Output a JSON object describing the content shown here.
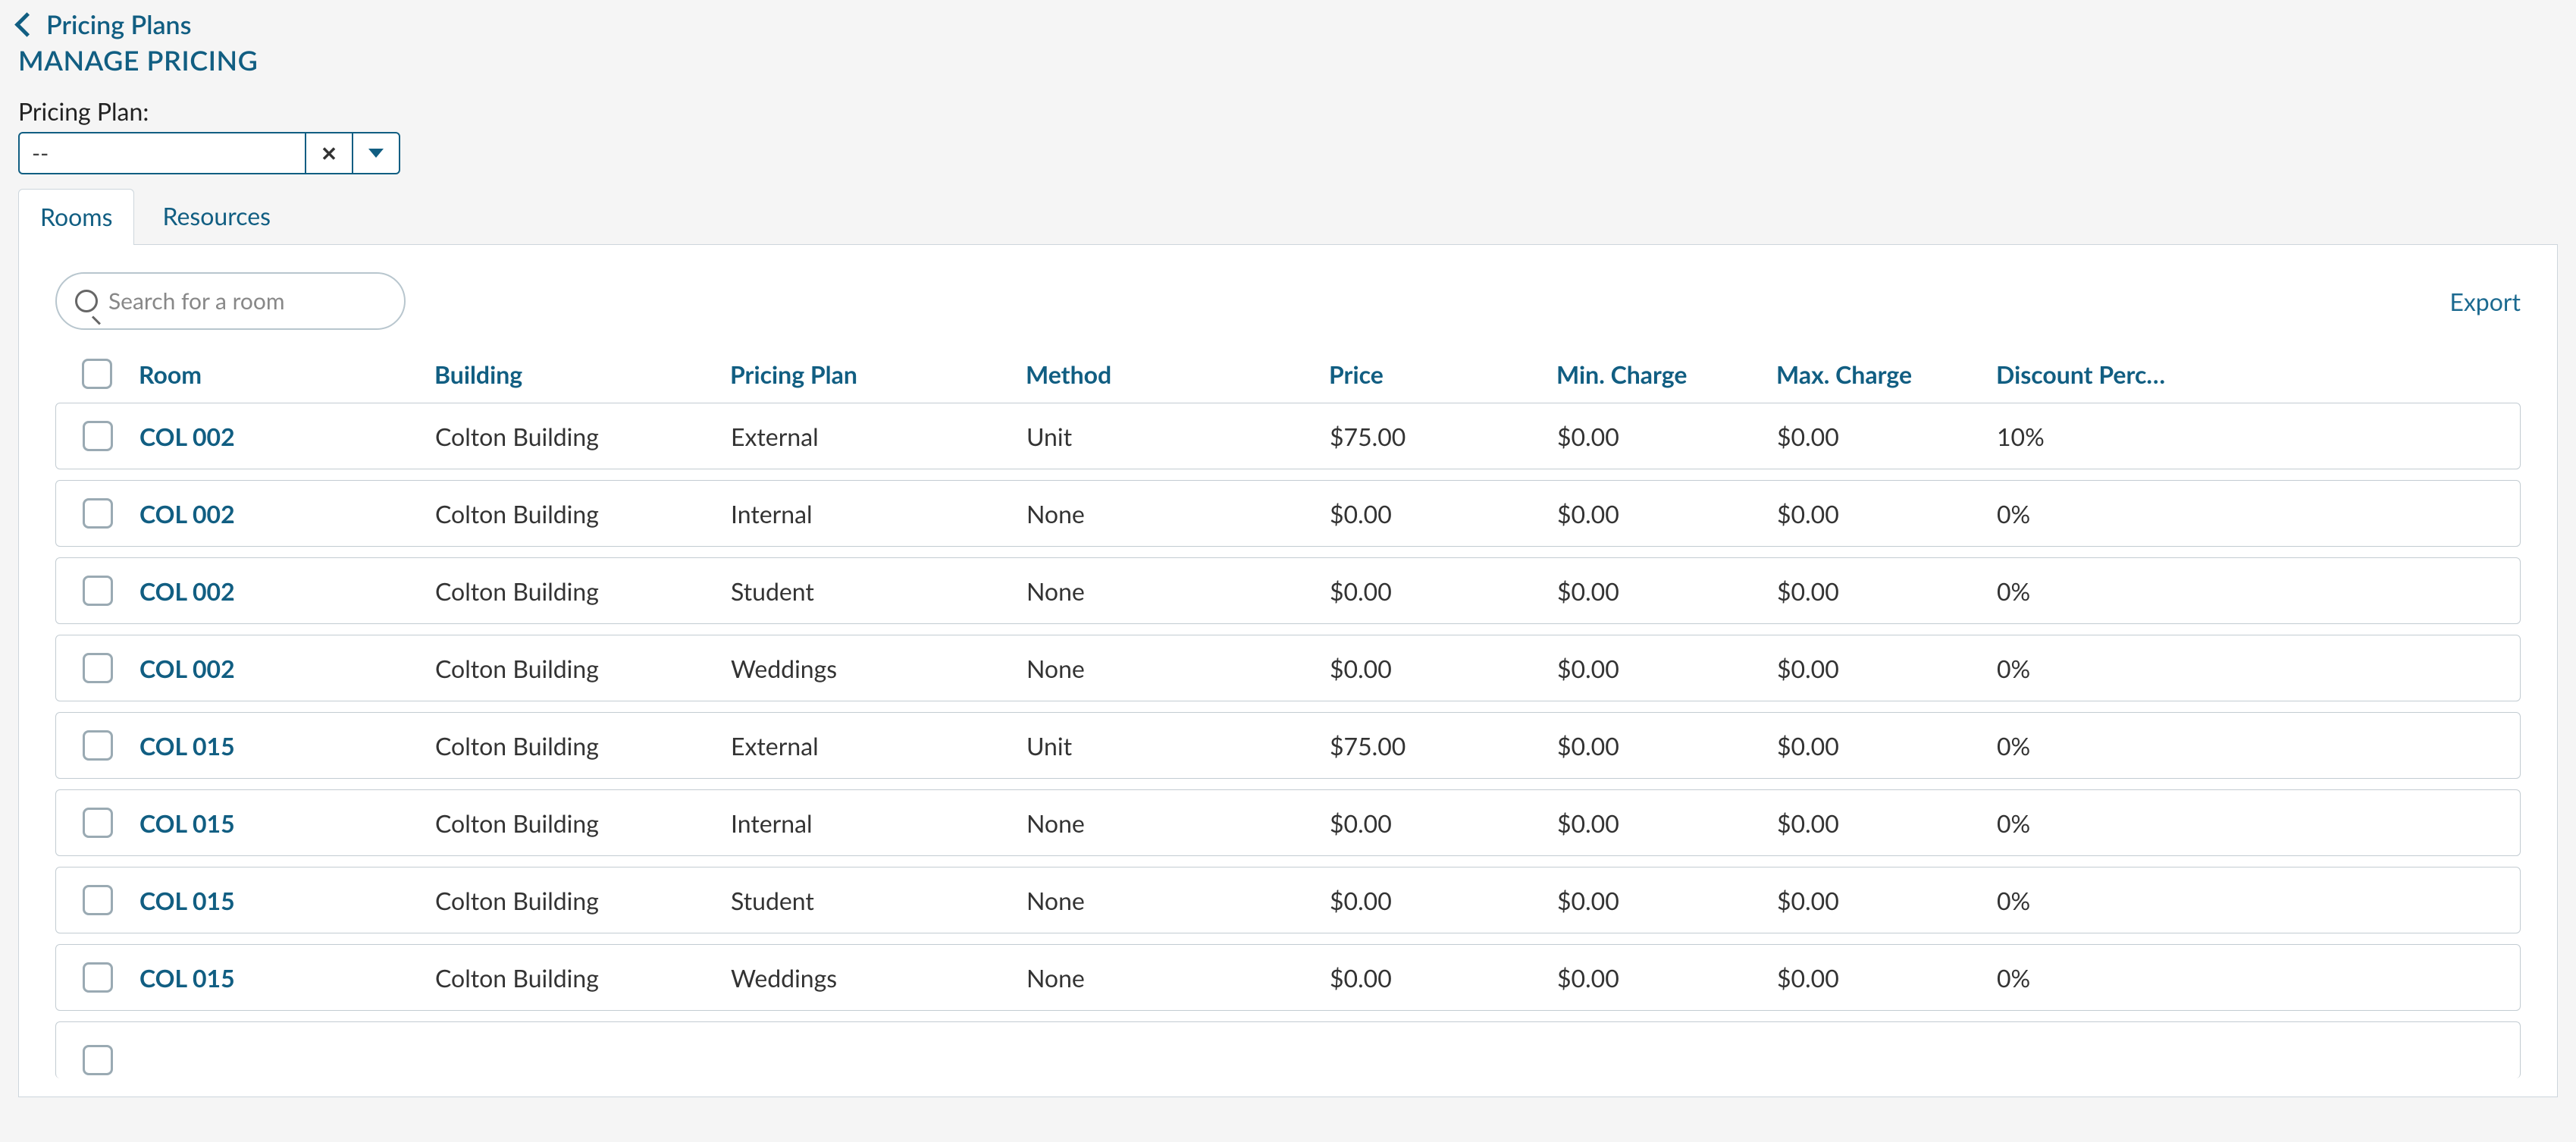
{
  "breadcrumb": {
    "back_label": "Pricing Plans"
  },
  "page": {
    "title": "MANAGE PRICING"
  },
  "filter": {
    "label": "Pricing Plan:",
    "value": "--"
  },
  "tabs": {
    "rooms": "Rooms",
    "resources": "Resources",
    "active": "rooms"
  },
  "toolbar": {
    "search_placeholder": "Search for a room",
    "export_label": "Export"
  },
  "columns": {
    "room": "Room",
    "building": "Building",
    "plan": "Pricing Plan",
    "method": "Method",
    "price": "Price",
    "min": "Min. Charge",
    "max": "Max. Charge",
    "disc": "Discount Perc…"
  },
  "rows": [
    {
      "room": "COL 002",
      "building": "Colton Building",
      "plan": "External",
      "method": "Unit",
      "price": "$75.00",
      "min": "$0.00",
      "max": "$0.00",
      "disc": "10%"
    },
    {
      "room": "COL 002",
      "building": "Colton Building",
      "plan": "Internal",
      "method": "None",
      "price": "$0.00",
      "min": "$0.00",
      "max": "$0.00",
      "disc": "0%"
    },
    {
      "room": "COL 002",
      "building": "Colton Building",
      "plan": "Student",
      "method": "None",
      "price": "$0.00",
      "min": "$0.00",
      "max": "$0.00",
      "disc": "0%"
    },
    {
      "room": "COL 002",
      "building": "Colton Building",
      "plan": "Weddings",
      "method": "None",
      "price": "$0.00",
      "min": "$0.00",
      "max": "$0.00",
      "disc": "0%"
    },
    {
      "room": "COL 015",
      "building": "Colton Building",
      "plan": "External",
      "method": "Unit",
      "price": "$75.00",
      "min": "$0.00",
      "max": "$0.00",
      "disc": "0%"
    },
    {
      "room": "COL 015",
      "building": "Colton Building",
      "plan": "Internal",
      "method": "None",
      "price": "$0.00",
      "min": "$0.00",
      "max": "$0.00",
      "disc": "0%"
    },
    {
      "room": "COL 015",
      "building": "Colton Building",
      "plan": "Student",
      "method": "None",
      "price": "$0.00",
      "min": "$0.00",
      "max": "$0.00",
      "disc": "0%"
    },
    {
      "room": "COL 015",
      "building": "Colton Building",
      "plan": "Weddings",
      "method": "None",
      "price": "$0.00",
      "min": "$0.00",
      "max": "$0.00",
      "disc": "0%"
    }
  ]
}
